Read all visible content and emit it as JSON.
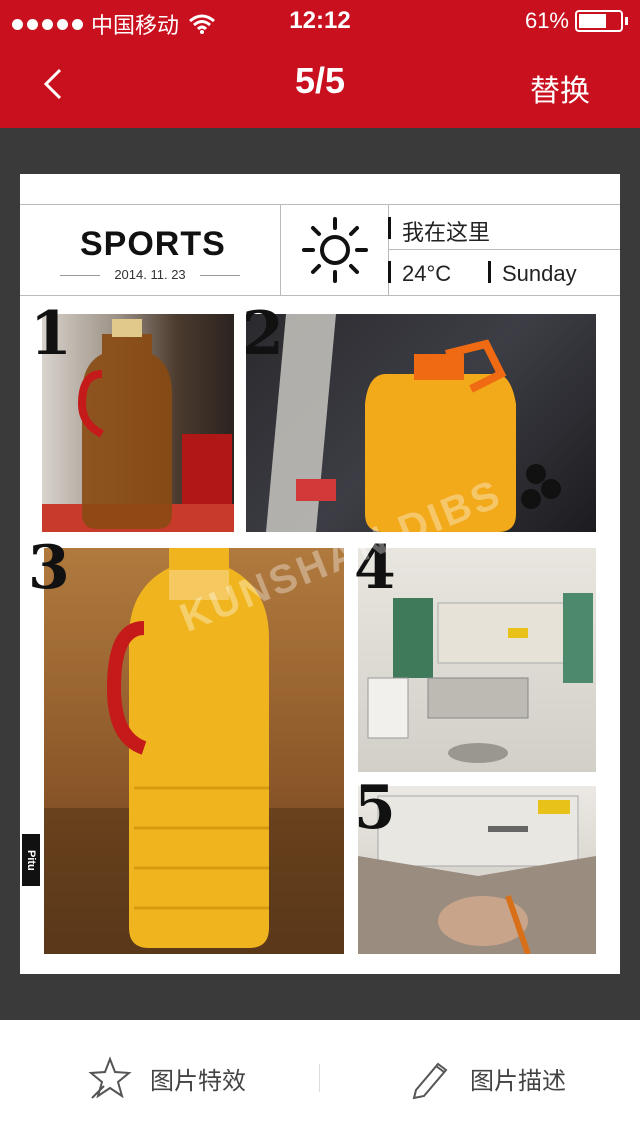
{
  "status_bar": {
    "carrier": "中国移动",
    "time": "12:12",
    "battery": "61%"
  },
  "nav": {
    "title": "5/5",
    "replace_label": "替换"
  },
  "poster": {
    "title": "SPORTS",
    "date": "2014. 11. 23",
    "location": "我在这里",
    "temperature": "24°C",
    "day": "Sunday",
    "photo_numbers": [
      "1",
      "2",
      "3",
      "4",
      "5"
    ],
    "pitu_label": "Pitu",
    "watermark": "KUNSHAN DIBS"
  },
  "footer": {
    "effects_label": "图片特效",
    "describe_label": "图片描述"
  },
  "colors": {
    "accent": "#c8101e",
    "canvas_bg": "#3a3a3a"
  },
  "icons": [
    "chevron-left-icon",
    "wifi-icon",
    "battery-icon",
    "sun-icon",
    "star-effects-icon",
    "pencil-icon"
  ]
}
